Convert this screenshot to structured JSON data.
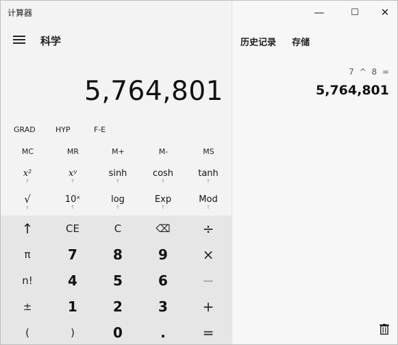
{
  "window": {
    "title": "计算器",
    "controls": {
      "minimize": "—",
      "maximize": "☐",
      "close": "✕"
    }
  },
  "header": {
    "menu_icon": "hamburger-icon",
    "mode": "科学"
  },
  "display": {
    "value": "5,764,801"
  },
  "units": {
    "angle": "GRAD",
    "hyp": "HYP",
    "fe": "F-E"
  },
  "memory": [
    "MC",
    "MR",
    "M+",
    "M-",
    "MS"
  ],
  "functions": [
    [
      {
        "main": "x²",
        "sub": "↑"
      },
      {
        "main": "xʸ",
        "sub": "↑"
      },
      {
        "main": "sinh",
        "sub": "↑"
      },
      {
        "main": "cosh",
        "sub": "↑"
      },
      {
        "main": "tanh",
        "sub": "↑"
      }
    ],
    [
      {
        "main": "√",
        "sub": "↑"
      },
      {
        "main": "10ˣ",
        "sub": "↑"
      },
      {
        "main": "log",
        "sub": "↑"
      },
      {
        "main": "Exp",
        "sub": "↑"
      },
      {
        "main": "Mod",
        "sub": "↑"
      }
    ]
  ],
  "keypad": [
    [
      "↑",
      "CE",
      "C",
      "⌫",
      "÷"
    ],
    [
      "π",
      "7",
      "8",
      "9",
      "×"
    ],
    [
      "n!",
      "4",
      "5",
      "6",
      "—"
    ],
    [
      "±",
      "1",
      "2",
      "3",
      "+"
    ],
    [
      "(",
      ")",
      "0",
      ".",
      "="
    ]
  ],
  "history_panel": {
    "tabs": [
      "历史记录",
      "存储"
    ],
    "entry_expression": "7 ^ 8 =",
    "entry_result": "5,764,801",
    "delete_icon": "trash-icon"
  }
}
